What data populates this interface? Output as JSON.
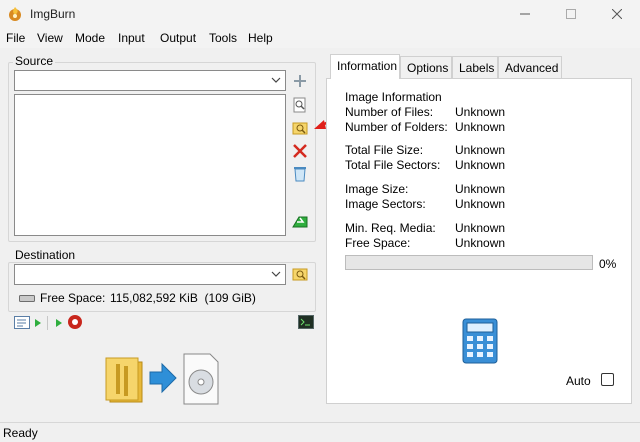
{
  "window": {
    "title": "ImgBurn"
  },
  "menu": [
    "File",
    "View",
    "Mode",
    "Input",
    "Output",
    "Tools",
    "Help"
  ],
  "source": {
    "group_label": "Source",
    "combo_value": ""
  },
  "destination": {
    "group_label": "Destination",
    "combo_value": "",
    "free_space_label": "Free Space:",
    "free_space_value": "115,082,592 KiB  (109 GiB)"
  },
  "tabs": [
    "Information",
    "Options",
    "Labels",
    "Advanced"
  ],
  "active_tab": "Information",
  "info": {
    "heading": "Image Information",
    "rows": [
      {
        "label": "Number of Files:",
        "value": "Unknown"
      },
      {
        "label": "Number of Folders:",
        "value": "Unknown"
      },
      {
        "label": "Total File Size:",
        "value": "Unknown"
      },
      {
        "label": "Total File Sectors:",
        "value": "Unknown"
      },
      {
        "label": "Image Size:",
        "value": "Unknown"
      },
      {
        "label": "Image Sectors:",
        "value": "Unknown"
      },
      {
        "label": "Min. Req. Media:",
        "value": "Unknown"
      },
      {
        "label": "Free Space:",
        "value": "Unknown"
      }
    ],
    "progress_percent": 0,
    "progress_text": "0%",
    "auto_label": "Auto",
    "auto_checked": false
  },
  "status": {
    "text": "Ready"
  },
  "colors": {
    "accent_red": "#e0201a",
    "progress_green": "#06b025"
  },
  "icons": [
    "imgburn-app-icon",
    "add-icon",
    "search-file-icon",
    "browse-folder-icon",
    "delete-icon",
    "recycle-icon",
    "calculate-icon",
    "log-icon",
    "build-icon",
    "calculator-icon",
    "folder-icon",
    "disc-image-icon"
  ]
}
